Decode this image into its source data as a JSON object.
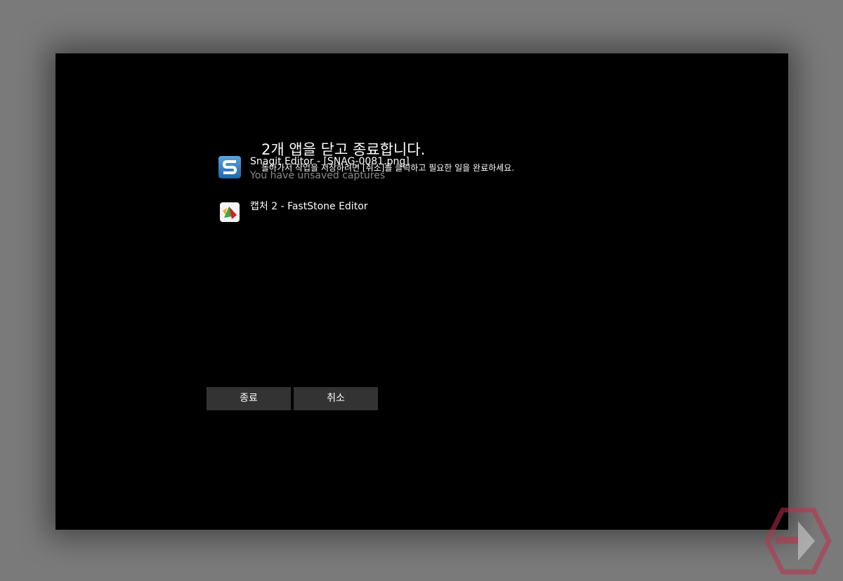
{
  "dialog": {
    "title": "2개 앱을 닫고 종료합니다.",
    "subtitle": "돌아가서 작업을 저장하려면 [취소]를 클릭하고 필요한 일을 완료하세요."
  },
  "apps": [
    {
      "name": "Snagit Editor - [SNAG-0081.png]",
      "status": "You have unsaved captures",
      "icon": "snagit-icon"
    },
    {
      "name": "캡처 2 - FastStone Editor",
      "status": "",
      "icon": "faststone-icon"
    }
  ],
  "buttons": {
    "shutdown_label": "종료",
    "cancel_label": "취소"
  },
  "colors": {
    "background": "#000000",
    "button": "#333333",
    "status_text": "#8a8a8a",
    "snagit_blue": "#2f7fc1",
    "watermark": "#c0304a"
  }
}
